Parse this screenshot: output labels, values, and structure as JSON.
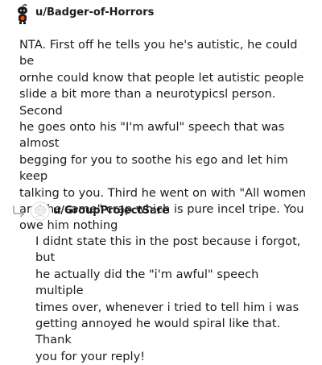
{
  "comments": [
    {
      "username": "u/Badger-of-Horrors",
      "avatar_icon": "snoo-avatar-icon",
      "body": "NTA. First off he tells you he's autistic, he could be\nornhe could know that people let autistic people\nslide a bit more than a neurotypicsl person. Second\nhe goes onto his \"I'm awful\" speech that was almost\nbegging for you to soothe his ego and let him keep\ntalking to you. Third he went on with \"All women\nare the same\" crap which is pure incel tripe. You\nowe him nothing"
    },
    {
      "username": "u/GroupProjectSare",
      "avatar_icon": "default-avatar-icon",
      "reply_icon": "reply-arrow-icon",
      "body": "I didnt state this in the post because i forgot, but\nhe actually did the \"i'm awful\" speech multiple\ntimes over, whenever i tried to tell him i was\ngetting annoyed he would spiral like that. Thank\nyou for your reply!"
    }
  ]
}
